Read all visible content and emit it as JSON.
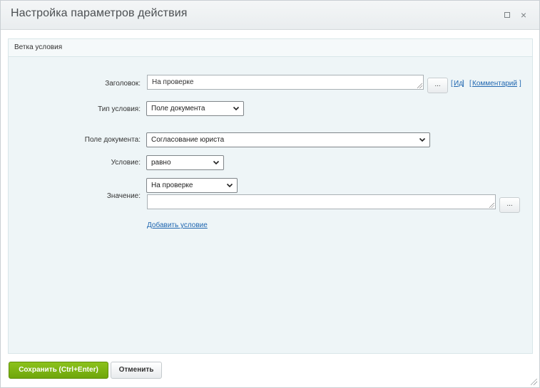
{
  "dialog": {
    "title": "Настройка параметров действия",
    "maximize_icon": "maximize-icon",
    "close_glyph": "×"
  },
  "panel": {
    "title": "Ветка условия"
  },
  "form": {
    "heading_label": "Заголовок:",
    "heading_value": "На проверке",
    "heading_dots": "...",
    "id_link": "Ид",
    "comment_link": "Комментарий",
    "bracket_open": "[",
    "bracket_close": "]",
    "condition_type_label": "Тип условия:",
    "condition_type_value": "Поле документа",
    "doc_field_label": "Поле документа:",
    "doc_field_value": "Согласование юриста",
    "condition_label": "Условие:",
    "condition_value": "равно",
    "value_label": "Значение:",
    "value_select": "На проверке",
    "value_text": "",
    "value_dots": "...",
    "add_condition_link": "Добавить условие"
  },
  "footer": {
    "save_label": "Сохранить (Ctrl+Enter)",
    "cancel_label": "Отменить"
  },
  "colors": {
    "accent_green": "#7ab317",
    "link_blue": "#2067b0",
    "panel_bg": "#eef5f7"
  }
}
